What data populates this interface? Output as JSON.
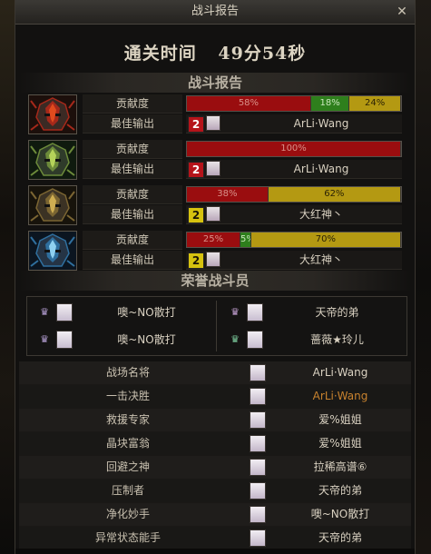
{
  "window": {
    "title": "战斗报告",
    "close_label": "✕"
  },
  "clear_time": {
    "label": "通关时间",
    "value": "49分54秒"
  },
  "report_section": {
    "title": "战斗报告"
  },
  "players": [
    {
      "portrait_icon": "red-flame-helmet-icon",
      "contribution_label": "贡献度",
      "contribution": [
        {
          "label": "58%",
          "value": 58,
          "color": "red"
        },
        {
          "label": "18%",
          "value": 18,
          "color": "green"
        },
        {
          "label": "24%",
          "value": 24,
          "color": "gold"
        }
      ],
      "best_label": "最佳输出",
      "best_rank": "2",
      "best_rank_color": "red",
      "best_name": "ArLi·Wang"
    },
    {
      "portrait_icon": "green-thorn-helmet-icon",
      "contribution_label": "贡献度",
      "contribution": [
        {
          "label": "100%",
          "value": 100,
          "color": "red"
        }
      ],
      "best_label": "最佳输出",
      "best_rank": "2",
      "best_rank_color": "red",
      "best_name": "ArLi·Wang"
    },
    {
      "portrait_icon": "gold-armor-helmet-icon",
      "contribution_label": "贡献度",
      "contribution": [
        {
          "label": "38%",
          "value": 38,
          "color": "red"
        },
        {
          "label": "62%",
          "value": 62,
          "color": "gold"
        }
      ],
      "best_label": "最佳输出",
      "best_rank": "2",
      "best_rank_color": "yellow",
      "best_name": "大红神丶"
    },
    {
      "portrait_icon": "blue-crystal-helmet-icon",
      "contribution_label": "贡献度",
      "contribution": [
        {
          "label": "25%",
          "value": 25,
          "color": "red"
        },
        {
          "label": "5%",
          "value": 5,
          "color": "green"
        },
        {
          "label": "70%",
          "value": 70,
          "color": "gold"
        }
      ],
      "best_label": "最佳输出",
      "best_rank": "2",
      "best_rank_color": "yellow",
      "best_name": "大红神丶"
    }
  ],
  "honor_section": {
    "title": "荣誉战斗员"
  },
  "honor_players": [
    {
      "name": "噢~NO散打",
      "crown": "♛"
    },
    {
      "name": "天帝的弟",
      "crown": "♛"
    },
    {
      "name": "噢~NO散打",
      "crown": "♛"
    },
    {
      "name": "蔷薇★玲儿",
      "crown": "♛"
    }
  ],
  "awards": [
    {
      "title": "战场名将",
      "name": "ArLi·Wang",
      "highlight": false
    },
    {
      "title": "一击决胜",
      "name": "ArLi·Wang",
      "highlight": true
    },
    {
      "title": "救援专家",
      "name": "爱%姐姐",
      "highlight": false
    },
    {
      "title": "晶块富翁",
      "name": "爱%姐姐",
      "highlight": false
    },
    {
      "title": "回避之神",
      "name": "拉稀高谱⑥",
      "highlight": false
    },
    {
      "title": "压制者",
      "name": "天帝的弟",
      "highlight": false
    },
    {
      "title": "净化妙手",
      "name": "噢~NO散打",
      "highlight": false
    },
    {
      "title": "异常状态能手",
      "name": "天帝的弟",
      "highlight": false
    }
  ],
  "colors": {
    "red": "#9a0d0f",
    "green": "#2e7f1c",
    "gold": "#b49912",
    "award_highlight": "#c8822e"
  }
}
